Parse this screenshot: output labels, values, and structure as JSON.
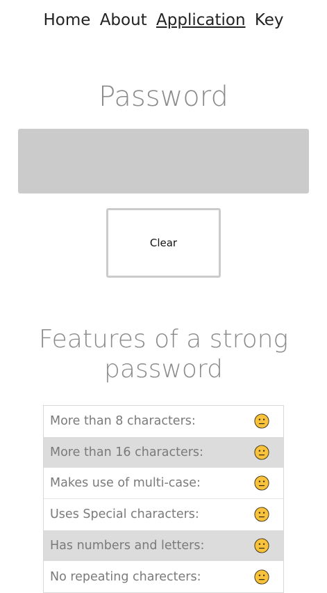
{
  "nav": {
    "items": [
      {
        "label": "Home",
        "active": false
      },
      {
        "label": "About",
        "active": false
      },
      {
        "label": "Application",
        "active": true
      },
      {
        "label": "Key",
        "active": false
      }
    ]
  },
  "password": {
    "title": "Password",
    "value": "",
    "placeholder": ""
  },
  "clear_button": {
    "label": "Clear"
  },
  "features": {
    "title": "Features of a strong password",
    "rows": [
      {
        "label": "More than 8 characters:",
        "status_icon": "neutral-face-icon"
      },
      {
        "label": "More than 16 characters:",
        "status_icon": "neutral-face-icon"
      },
      {
        "label": "Makes use of multi-case:",
        "status_icon": "neutral-face-icon"
      },
      {
        "label": "Uses Special characters:",
        "status_icon": "neutral-face-icon"
      },
      {
        "label": "Has numbers and letters:",
        "status_icon": "neutral-face-icon"
      },
      {
        "label": "No repeating charecters:",
        "status_icon": "neutral-face-icon"
      }
    ]
  },
  "colors": {
    "title_gray": "#8a8a8a",
    "input_bg": "#cbcbcb",
    "row_alt_bg": "#dcdcdc",
    "face_yellow": "#f9c23c"
  }
}
